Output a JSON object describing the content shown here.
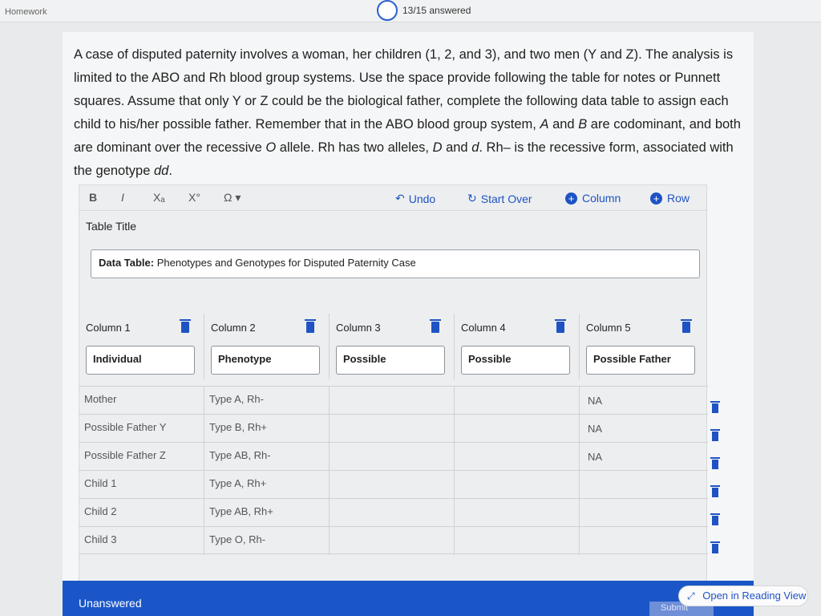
{
  "topbar": {
    "section_label": "Homework",
    "progress_text": "13/15 answered"
  },
  "question": {
    "part1": "A case of disputed paternity involves a woman, her children (1, 2, and 3), and two men (Y and Z). The analysis is limited to the ABO and Rh blood group systems. Use the space provide following the table for notes or Punnett squares. Assume that only Y or Z could be the biological father, complete the following data table to assign each child to his/her possible father. Remember that in the ABO blood group system, ",
    "a": "A",
    "and": " and ",
    "b": "B",
    "part2": " are codominant, and both are dominant over the recessive ",
    "o": "O",
    "part3": " allele. Rh has two alleles, ",
    "d1": "D",
    "and2": " and ",
    "d2": "d",
    "part4": ". Rh– is the recessive form, associated with the genotype ",
    "dd": "dd",
    "end": "."
  },
  "toolbar": {
    "bold": "B",
    "italic": "I",
    "subscript": "Xₐ",
    "superscript": "X°",
    "omega": "Ω ▾",
    "undo": "Undo",
    "start_over": "Start Over",
    "add_column": "Column",
    "add_row": "Row"
  },
  "table_title_label": "Table Title",
  "table_title_value": {
    "bold": "Data Table:",
    "rest": " Phenotypes and Genotypes for Disputed Paternity Case"
  },
  "columns": [
    {
      "label": "Column 1",
      "header": "Individual"
    },
    {
      "label": "Column 2",
      "header": "Phenotype"
    },
    {
      "label": "Column 3",
      "header": "Possible"
    },
    {
      "label": "Column 4",
      "header": "Possible"
    },
    {
      "label": "Column 5",
      "header": "Possible Father"
    }
  ],
  "rows": [
    [
      "Mother",
      "Type A, Rh-",
      "",
      "",
      "NA"
    ],
    [
      "Possible Father Y",
      "Type B, Rh+",
      "",
      "",
      "NA"
    ],
    [
      "Possible Father Z",
      "Type AB, Rh-",
      "",
      "",
      "NA"
    ],
    [
      "Child 1",
      "Type A, Rh+",
      "",
      "",
      ""
    ],
    [
      "Child 2",
      "Type AB, Rh+",
      "",
      "",
      ""
    ],
    [
      "Child 3",
      "Type O, Rh-",
      "",
      "",
      ""
    ]
  ],
  "bottom": {
    "status": "Unanswered",
    "submit": "Submit",
    "reading_view": "Open in Reading View"
  },
  "colors": {
    "accent": "#1f53c4",
    "bottom_bar": "#1b56c8"
  },
  "icons": {
    "undo": "undo-arrow-icon",
    "start_over": "refresh-icon",
    "plus": "plus-circle-icon",
    "trash": "trash-icon",
    "expand": "expand-arrows-icon"
  }
}
